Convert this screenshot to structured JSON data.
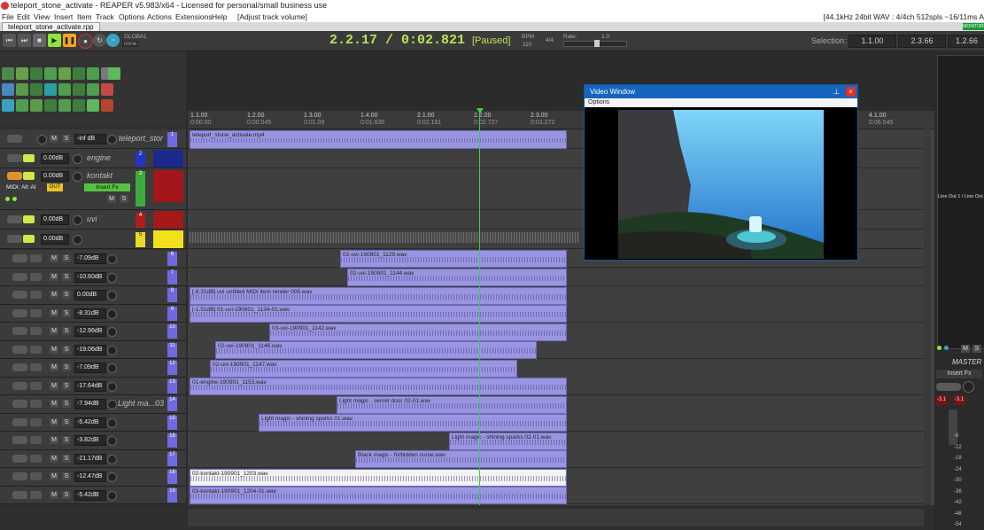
{
  "window": {
    "title": "teleport_stone_activate - REAPER v5.983/x64 - Licensed for personal/small business use"
  },
  "menu": [
    "File",
    "Edit",
    "View",
    "Insert",
    "Item",
    "Track",
    "Options",
    "Actions",
    "Extensions",
    "Help",
    "[Adjust track volume]"
  ],
  "menu_right": "[44.1kHz 24bit WAV : 4/4ch 512spls ~16/11ms A",
  "tab": {
    "label": "teleport_stone_activate.rpp"
  },
  "monitor_badge": "MONITOR",
  "transport": {
    "global_label": "GLOBAL",
    "none_label": "none",
    "time": "2.2.17 / 0:02.821",
    "state": "[Paused]",
    "bpm_label": "BPM",
    "bpm": "110",
    "sig": "4/4",
    "rate_label": "Rate:",
    "rate": "1.0",
    "selection_label": "Selection:",
    "sel_start": "1.1.00",
    "sel_end": "2.3.66",
    "sel_len": "1.2.66"
  },
  "ruler": [
    {
      "bar": "1.1.00",
      "time": "0:00.00"
    },
    {
      "bar": "1.2.00",
      "time": "0:00.545"
    },
    {
      "bar": "1.3.00",
      "time": "0:01.09"
    },
    {
      "bar": "1.4.00",
      "time": "0:01.636"
    },
    {
      "bar": "2.1.00",
      "time": "0:02.181"
    },
    {
      "bar": "2.2.00",
      "time": "0:02.727"
    },
    {
      "bar": "2.3.00",
      "time": "0:03.272"
    },
    {
      "bar": "4.1.00",
      "time": "0:06.545"
    }
  ],
  "tracks": [
    {
      "num": "1",
      "name": "teleport_stor",
      "vol": "-inf dB"
    },
    {
      "num": "2",
      "name": "engine",
      "vol": "0.00dB"
    },
    {
      "num": "3",
      "name": "kontakt",
      "vol": "0.00dB",
      "midi": "MIDI: All: Al",
      "out": "OUT",
      "fx": "Insert Fx"
    },
    {
      "num": "4",
      "name": "uvi",
      "vol": "0.00dB"
    },
    {
      "num": "5",
      "name": "",
      "vol": "0.00dB"
    },
    {
      "num": "6",
      "name": "",
      "vol": "-7.09dB"
    },
    {
      "num": "7",
      "name": "",
      "vol": "-10.60dB"
    },
    {
      "num": "8",
      "name": "",
      "vol": "0.00dB"
    },
    {
      "num": "9",
      "name": "",
      "vol": "-8.31dB"
    },
    {
      "num": "10",
      "name": "",
      "vol": "-12.96dB"
    },
    {
      "num": "11",
      "name": "",
      "vol": "-19.06dB"
    },
    {
      "num": "12",
      "name": "",
      "vol": "-7.09dB"
    },
    {
      "num": "13",
      "name": "",
      "vol": "-17.64dB"
    },
    {
      "num": "14",
      "name": "Light ma...03",
      "vol": "-7.94dB"
    },
    {
      "num": "15",
      "name": "",
      "vol": "-5.42dB"
    },
    {
      "num": "16",
      "name": "",
      "vol": "-3.82dB"
    },
    {
      "num": "17",
      "name": "",
      "vol": "-21.17dB"
    },
    {
      "num": "18",
      "name": "",
      "vol": "-12.47dB"
    },
    {
      "num": "19",
      "name": "",
      "vol": "-5.42dB"
    }
  ],
  "items": [
    "teleport_stone_activate.mp4",
    "02-uvi-190901_1129.wav",
    "02-uvi-190901_1144.wav",
    "[-8.31dB] uvi untitled MIDI item render 005.wav",
    "[-1.51dB] 01-uvi-190901_1134-01.wav",
    "03-uvi-190901_1142.wav",
    "02-uvi-190901_1146.wav",
    "02-uvi-190901_1147.wav",
    "01-engine-190901_1153.wav",
    "Light magic - secret door 02-01.wav",
    "Light magic - shining sparks 01.wav",
    "Light magic - shining sparks 02-01.wav",
    "Black magic - forbidden curse.wav",
    "02-kontakt-190901_1203.wav",
    "03-kontakt-190901_1204-01.wav"
  ],
  "video": {
    "title": "Video Window",
    "options": "Options"
  },
  "mixer": {
    "io": "Line Out 1 / Line Out",
    "master": "MASTER",
    "fx": "Insert Fx",
    "m": "M",
    "s": "S",
    "peak_l": "-3.1",
    "peak_r": "-3.1",
    "scale": [
      "-6",
      "-12",
      "-18",
      "-24",
      "-30",
      "-36",
      "-42",
      "-48",
      "-54"
    ]
  },
  "colors": {
    "accent": "#b9e35a",
    "item": "#9a95e0",
    "video_title": "#1565c0",
    "track_num": "#6f6adf"
  }
}
